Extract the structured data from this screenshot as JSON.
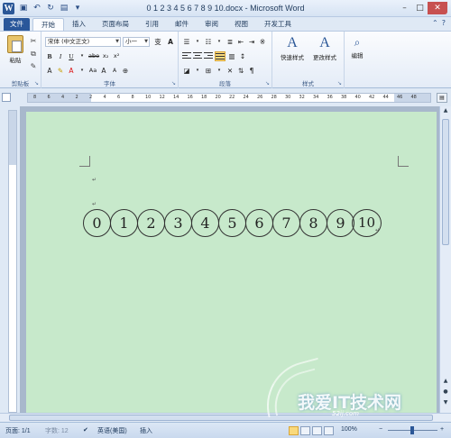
{
  "window": {
    "app_icon": "W",
    "title": "0 1 2 3 4 5 6 7 8 9 10.docx - Microsoft Word",
    "qat_icons": [
      "save-icon",
      "undo-icon",
      "redo-icon",
      "print-preview-icon",
      "customize-icon"
    ],
    "buttons": {
      "minimize": "–",
      "maximize": "□",
      "close": "✕"
    }
  },
  "tabs": [
    {
      "label": "文件"
    },
    {
      "label": "开始"
    },
    {
      "label": "插入"
    },
    {
      "label": "页面布局"
    },
    {
      "label": "引用"
    },
    {
      "label": "邮件"
    },
    {
      "label": "审阅"
    },
    {
      "label": "视图"
    },
    {
      "label": "开发工具"
    }
  ],
  "ribbon": {
    "clipboard": {
      "paste": "粘贴",
      "label": "剪贴板"
    },
    "font": {
      "font_name": "宋体 (中文正文)",
      "font_size": "小一",
      "bold": "B",
      "italic": "I",
      "underline": "U",
      "strike": "abe",
      "subscript": "x₂",
      "superscript": "x²",
      "grow": "A",
      "shrink": "A",
      "change_case": "Aa",
      "font_color": "A",
      "label": "字体"
    },
    "paragraph": {
      "label": "段落"
    },
    "styles": {
      "quick": "快速样式",
      "change": "更改样式",
      "label": "样式"
    },
    "editing": {
      "label": "编辑"
    }
  },
  "ruler": {
    "numbers": [
      "8",
      "6",
      "4",
      "2",
      "2",
      "4",
      "6",
      "8",
      "10",
      "12",
      "14",
      "16",
      "18",
      "20",
      "22",
      "24",
      "26",
      "28",
      "30",
      "32",
      "34",
      "36",
      "38",
      "40",
      "42",
      "44",
      "46",
      "48"
    ]
  },
  "document": {
    "circled_numbers": [
      "0",
      "1",
      "2",
      "3",
      "4",
      "5",
      "6",
      "7",
      "8",
      "9",
      "10"
    ],
    "para_mark": "↵"
  },
  "status": {
    "page": "页面: 1/1",
    "words": "字数: 12",
    "language": "英语(美国)",
    "mode": "插入",
    "zoom": "100%"
  },
  "watermark": {
    "text": "我爱IT技术网",
    "sub": "52ij.com"
  }
}
